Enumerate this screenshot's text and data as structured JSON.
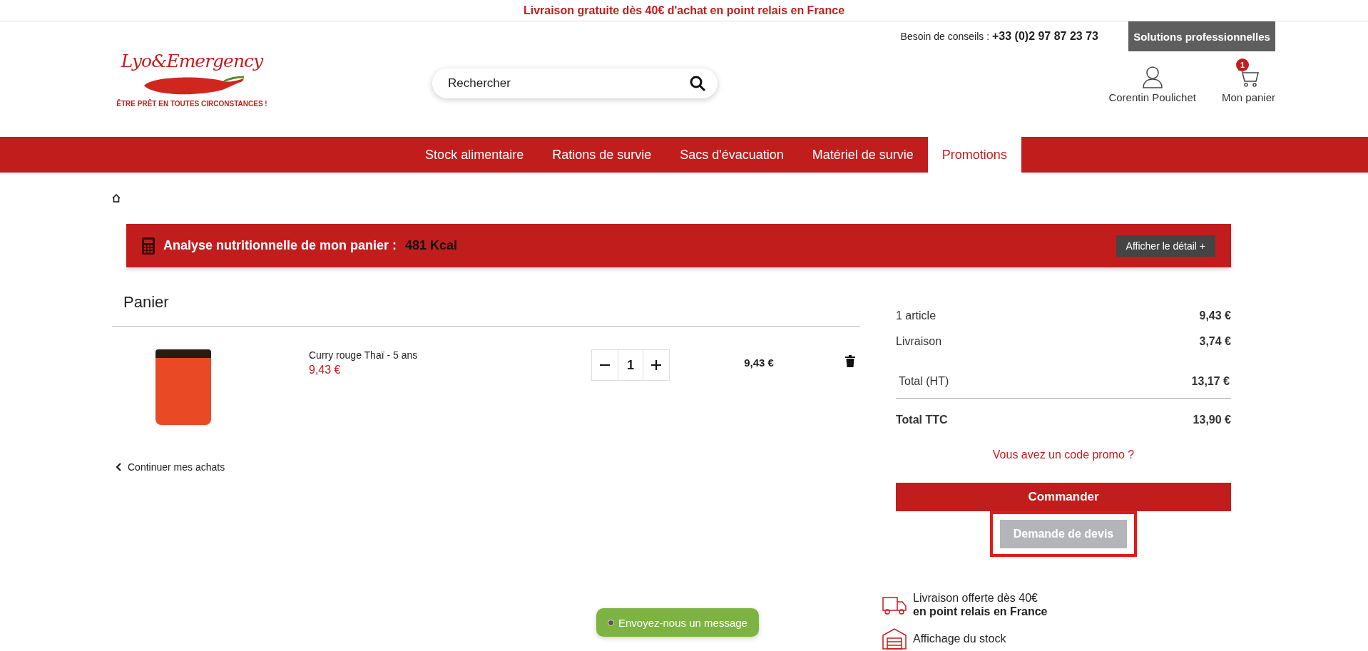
{
  "announcement": "Livraison gratuite dès 40€ d'achat en point relais en France",
  "header": {
    "logo_text": "Lyo&Emergency",
    "tagline": "ÊTRE PRÊT EN TOUTES CIRCONSTANCES !",
    "help_label": "Besoin de conseils :",
    "phone": "+33 (0)2 97 87 23 73",
    "pro_button": "Solutions professionnelles",
    "search": {
      "placeholder": "Rechercher"
    },
    "account": "Corentin Poulichet",
    "cart": {
      "label": "Mon panier",
      "count": "1"
    }
  },
  "nav": [
    {
      "label": "Stock alimentaire",
      "selected": false
    },
    {
      "label": "Rations de survie",
      "selected": false
    },
    {
      "label": "Sacs d'évacuation",
      "selected": false
    },
    {
      "label": "Matériel de survie",
      "selected": false
    },
    {
      "label": "Promotions",
      "selected": true
    }
  ],
  "nutrition": {
    "label": "Analyse nutritionnelle de mon panier :",
    "value": "481 Kcal",
    "button": "Afficher le détail +"
  },
  "cart": {
    "title": "Panier",
    "items": [
      {
        "name": "Curry rouge Thaï - 5 ans",
        "unit_price": "9,43 €",
        "quantity": "1",
        "total": "9,43 €"
      }
    ],
    "continue_link": "Continuer mes achats"
  },
  "summary": {
    "lines": [
      {
        "label": "1 article",
        "value": "9,43 €",
        "kind": "line"
      },
      {
        "label": "Livraison",
        "value": "3,74 €",
        "kind": "line"
      },
      {
        "label": "Total (HT)",
        "value": "13,17 €",
        "kind": "subtotal"
      },
      {
        "label": "Total TTC",
        "value": "13,90 €",
        "kind": "total"
      }
    ],
    "promo_link": "Vous avez un code promo ?",
    "order_button": "Commander",
    "quote_button": "Demande de devis"
  },
  "advantages": [
    {
      "kind": "delivery",
      "lines": [
        "Livraison offerte dès 40€",
        "en point relais en France"
      ]
    },
    {
      "kind": "stock",
      "lines": [
        "Affichage du stock"
      ]
    }
  ],
  "chat": {
    "label": "Envoyez-nous un message"
  }
}
